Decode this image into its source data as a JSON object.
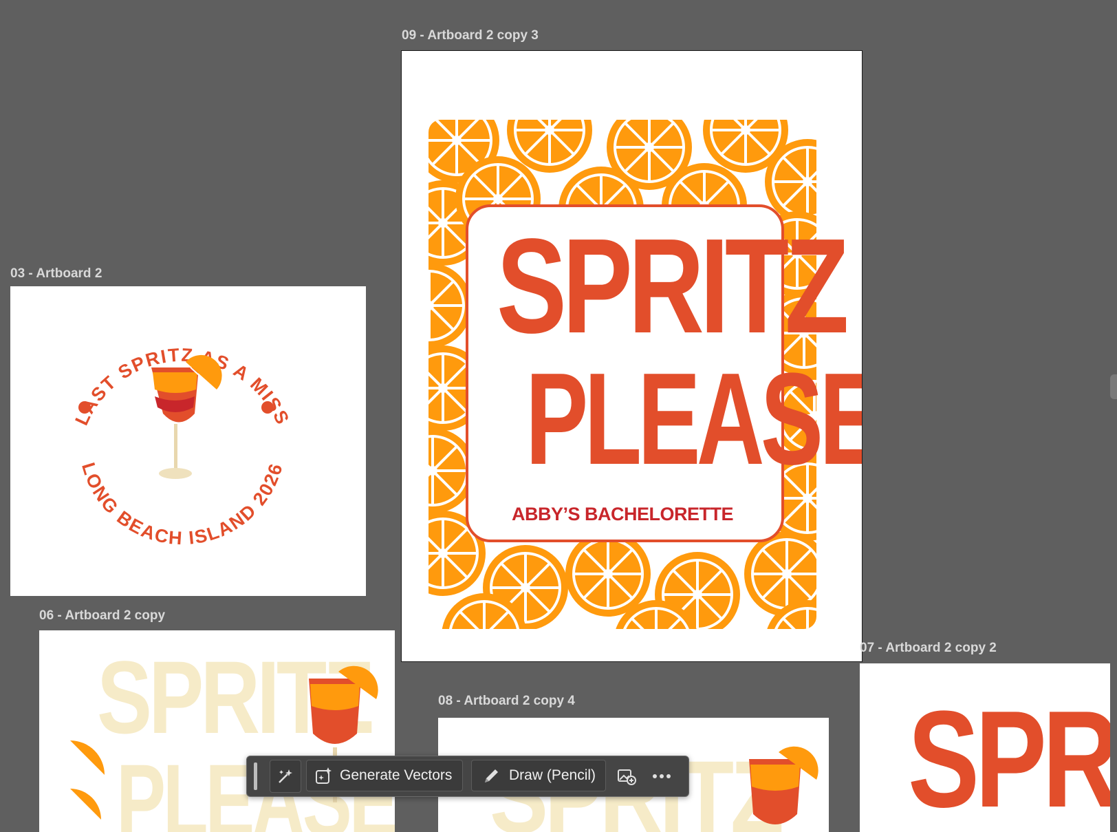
{
  "artboards": {
    "ab09": {
      "label": "09 - Artboard 2 copy 3",
      "title_line1": "SPRITZ",
      "title_line2": "PLEASE!",
      "subtitle": "ABBY’S BACHELORETTE"
    },
    "ab03": {
      "label": "03 - Artboard 2",
      "arc_top": "LAST SPRITZ AS A MISS",
      "arc_bottom": "LONG BEACH ISLAND 2026"
    },
    "ab06": {
      "label": "06 - Artboard 2 copy",
      "line1": "SPRITZ",
      "line2": "PLEASE!"
    },
    "ab08": {
      "label": "08 - Artboard 2 copy 4",
      "line1": "SPRITZ"
    },
    "ab07": {
      "label": "07 - Artboard 2 copy 2",
      "line1": "SPRITZ"
    }
  },
  "toolbar": {
    "generate_label": "Generate Vectors",
    "draw_label": "Draw (Pencil)",
    "icons": [
      "magic-wand-icon",
      "generate-vectors-icon",
      "pencil-icon",
      "add-image-icon",
      "more-icon"
    ]
  },
  "colors": {
    "canvas": "#5f5f5f",
    "red_orange": "#e24e2b",
    "orange": "#ff9a0d",
    "cream": "#f6ebc8",
    "toolbar": "#454545"
  }
}
